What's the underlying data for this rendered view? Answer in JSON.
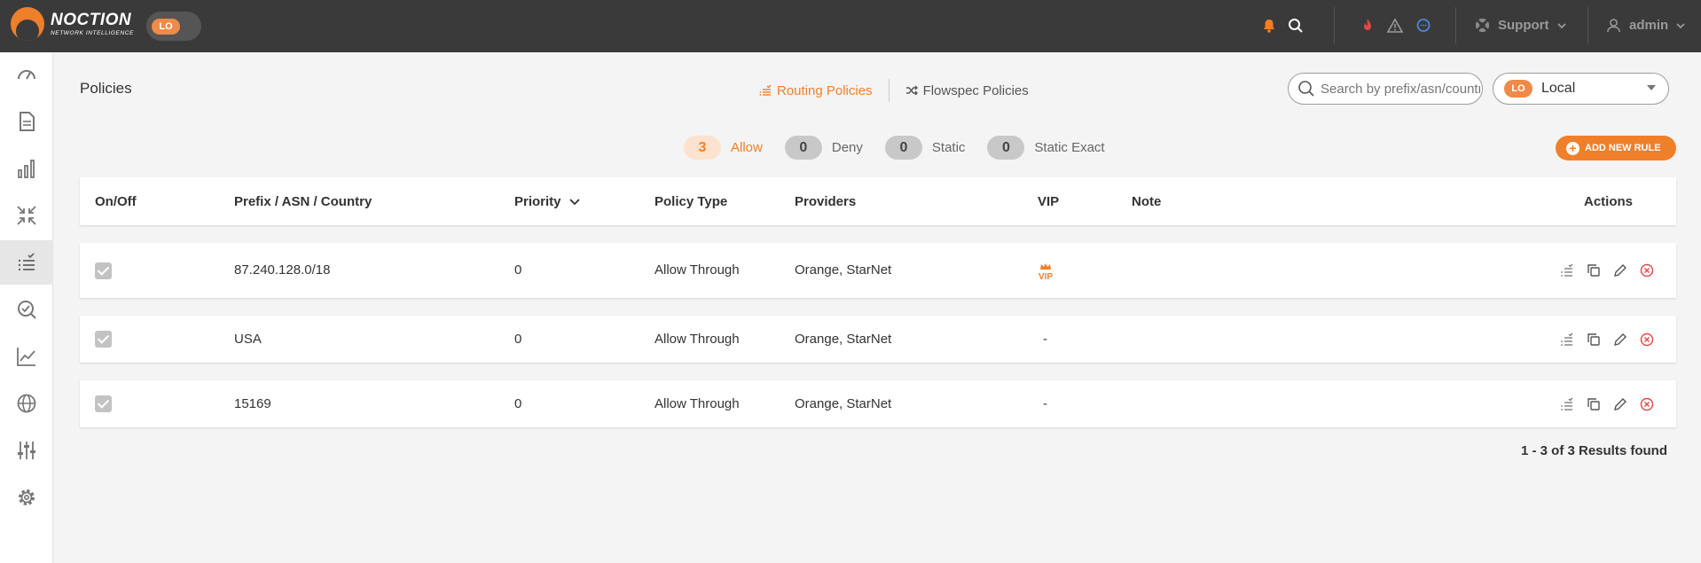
{
  "app": {
    "logo_name": "NOCTION",
    "logo_sub": "NETWORK INTELLIGENCE",
    "env_badge": "LO"
  },
  "topbar": {
    "support_label": "Support",
    "user_label": "admin"
  },
  "sidebar": {
    "items": [
      {
        "icon": "dashboard-icon"
      },
      {
        "icon": "document-icon"
      },
      {
        "icon": "bar-chart-icon"
      },
      {
        "icon": "collapse-arrows-icon"
      },
      {
        "icon": "policies-list-icon",
        "active": true
      },
      {
        "icon": "check-search-icon"
      },
      {
        "icon": "line-graph-icon"
      },
      {
        "icon": "globe-icon"
      },
      {
        "icon": "sliders-icon"
      },
      {
        "icon": "gear-icon"
      }
    ]
  },
  "page": {
    "title": "Policies"
  },
  "tabs": [
    {
      "label": "Routing Policies",
      "active": true
    },
    {
      "label": "Flowspec Policies",
      "active": false
    }
  ],
  "search": {
    "placeholder": "Search by prefix/asn/country"
  },
  "select": {
    "badge": "LO",
    "value": "Local"
  },
  "filters": [
    {
      "count": "3",
      "label": "Allow",
      "active": true
    },
    {
      "count": "0",
      "label": "Deny"
    },
    {
      "count": "0",
      "label": "Static"
    },
    {
      "count": "0",
      "label": "Static Exact"
    }
  ],
  "add_button": {
    "label": "ADD NEW RULE"
  },
  "table": {
    "columns": [
      "On/Off",
      "Prefix / ASN / Country",
      "Priority",
      "Policy Type",
      "Providers",
      "VIP",
      "Note",
      "Actions"
    ],
    "rows": [
      {
        "enabled": true,
        "prefix": "87.240.128.0/18",
        "priority": "0",
        "policy_type": "Allow Through",
        "providers": "Orange, StarNet",
        "vip": "VIP",
        "note": ""
      },
      {
        "enabled": true,
        "prefix": "USA",
        "priority": "0",
        "policy_type": "Allow Through",
        "providers": "Orange, StarNet",
        "vip": "-",
        "note": ""
      },
      {
        "enabled": true,
        "prefix": "15169",
        "priority": "0",
        "policy_type": "Allow Through",
        "providers": "Orange, StarNet",
        "vip": "-",
        "note": ""
      }
    ]
  },
  "results": {
    "text": "1 - 3 of 3 Results found"
  },
  "colors": {
    "accent": "#f07f2a",
    "topbar": "#3a3a3a",
    "danger": "#e04848",
    "info": "#4a8ad8"
  }
}
